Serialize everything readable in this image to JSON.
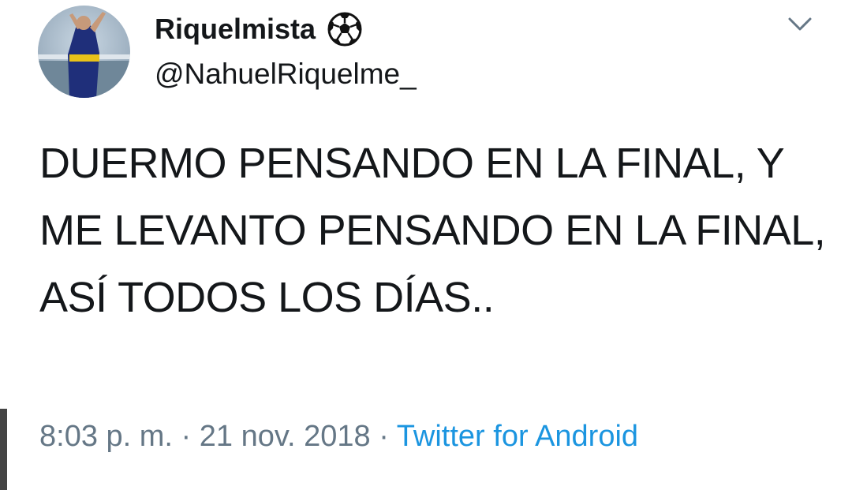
{
  "user": {
    "display_name": "Riquelmista",
    "handle": "@NahuelRiquelme_",
    "avatar_icon": "profile-photo",
    "badge_icon": "soccer-ball-icon"
  },
  "menu": {
    "icon": "chevron-down-icon"
  },
  "tweet": {
    "text": "DUERMO PENSANDO EN LA FINAL, Y ME LEVANTO PENSANDO EN LA FINAL, ASÍ TODOS LOS DÍAS..",
    "time": "8:03 p. m.",
    "separator1": "·",
    "date": "21 nov. 2018",
    "separator2": "·",
    "source": "Twitter for Android"
  },
  "colors": {
    "text": "#14171a",
    "meta": "#657786",
    "link": "#1b95e0",
    "chevron": "#657786"
  }
}
